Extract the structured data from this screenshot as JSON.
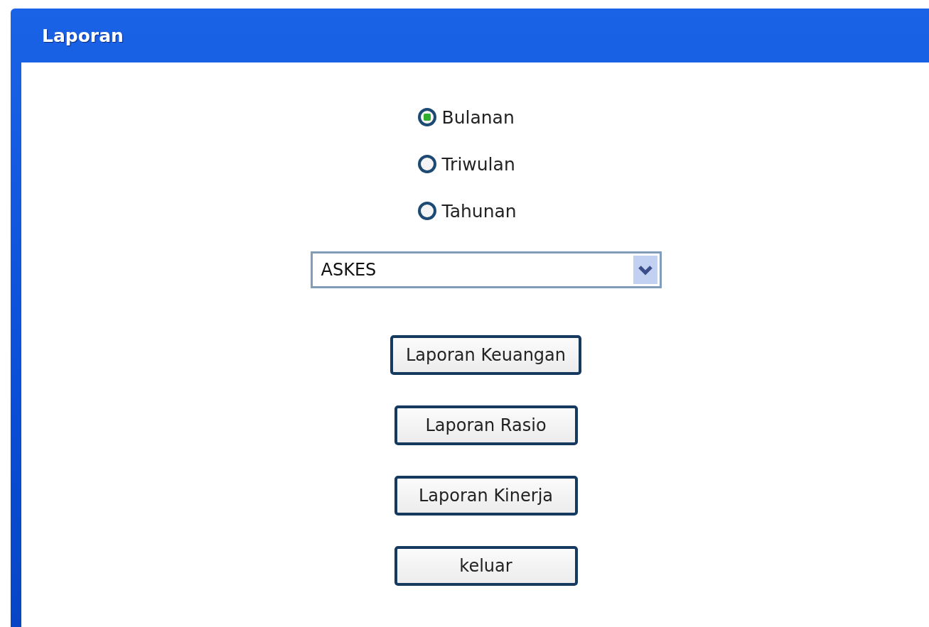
{
  "window": {
    "title": "Laporan"
  },
  "period_options": [
    {
      "label": "Bulanan",
      "selected": true
    },
    {
      "label": "Triwulan",
      "selected": false
    },
    {
      "label": "Tahunan",
      "selected": false
    }
  ],
  "dropdown": {
    "value": "ASKES"
  },
  "buttons": [
    "Laporan Keuangan",
    "Laporan Rasio",
    "Laporan Kinerja",
    "keluar"
  ]
}
